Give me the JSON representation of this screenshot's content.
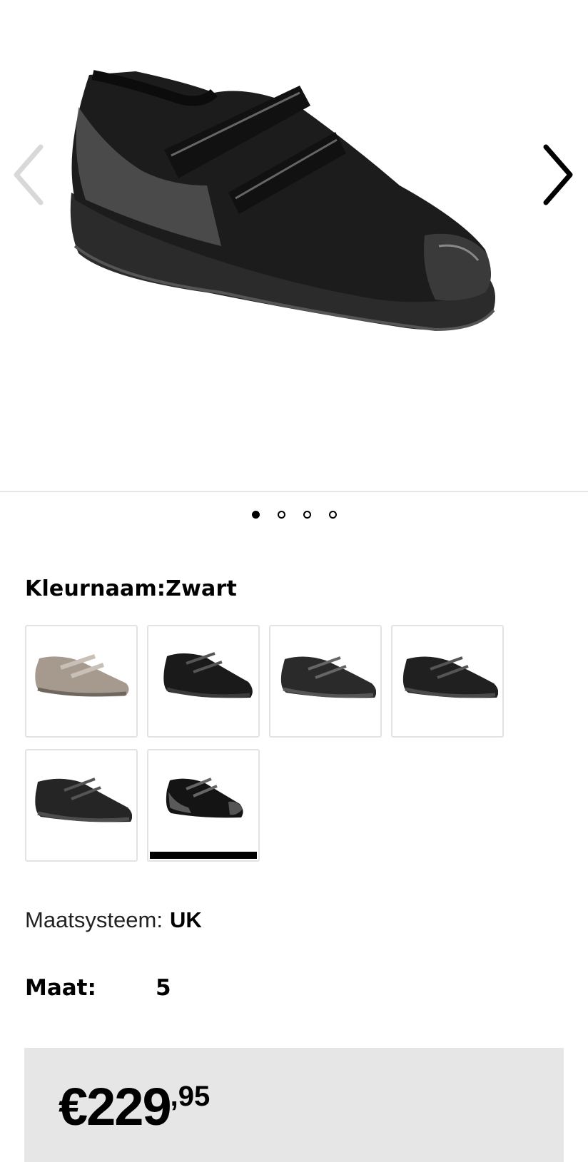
{
  "gallery": {
    "prev_icon": "chevron-left-icon",
    "next_icon": "chevron-right-icon",
    "dot_count": 4,
    "active_dot": 1
  },
  "color": {
    "label": "Kleurnaam:Zwart",
    "swatches": [
      {
        "name": "taupe",
        "color": "#a69a8e"
      },
      {
        "name": "black-1",
        "color": "#1a1a1a"
      },
      {
        "name": "black-2",
        "color": "#2a2a2a"
      },
      {
        "name": "black-3",
        "color": "#202020"
      },
      {
        "name": "black-4",
        "color": "#252525"
      },
      {
        "name": "black-patent",
        "color": "#141414",
        "selected": true
      }
    ]
  },
  "size_system": {
    "label": "Maatsysteem:",
    "value": "UK"
  },
  "size": {
    "label": "Maat:",
    "value": "5"
  },
  "price": {
    "main": "€229",
    "cents": ",95"
  }
}
